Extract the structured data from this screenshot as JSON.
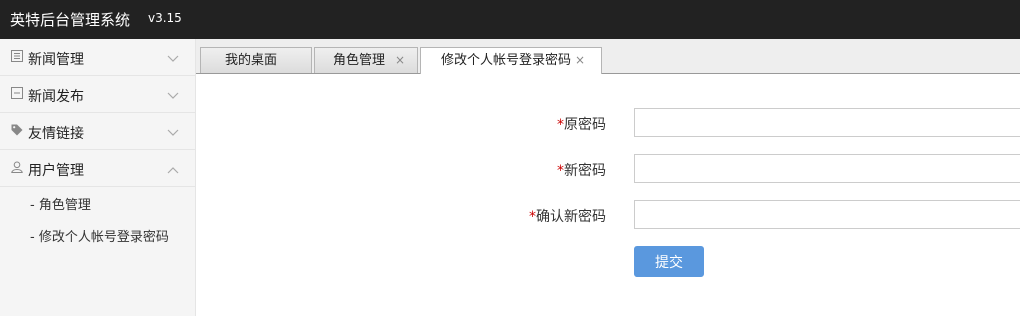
{
  "header": {
    "title": "英特后台管理系统",
    "version": "v3.15"
  },
  "sidebar": {
    "items": [
      {
        "label": "新闻管理",
        "icon": "news-list-icon",
        "expanded": false
      },
      {
        "label": "新闻发布",
        "icon": "publish-icon",
        "expanded": false
      },
      {
        "label": "友情链接",
        "icon": "tag-icon",
        "expanded": false
      },
      {
        "label": "用户管理",
        "icon": "user-icon",
        "expanded": true
      }
    ],
    "sub_items": [
      {
        "label": "- 角色管理"
      },
      {
        "label": "- 修改个人帐号登录密码"
      }
    ]
  },
  "tabs": [
    {
      "label": "我的桌面",
      "closable": false,
      "active": false
    },
    {
      "label": "角色管理",
      "closable": true,
      "close": "×",
      "active": false
    },
    {
      "label": "修改个人帐号登录密码",
      "closable": true,
      "close": "×",
      "active": true
    }
  ],
  "form": {
    "old_password_label": "原密码",
    "new_password_label": "新密码",
    "confirm_password_label": "确认新密码",
    "required_mark": "*",
    "old_password_value": "",
    "new_password_value": "",
    "confirm_password_value": "",
    "submit_label": "提交"
  },
  "colors": {
    "topbar": "#222222",
    "primary_button": "#5a98de",
    "required": "#cc0000"
  }
}
